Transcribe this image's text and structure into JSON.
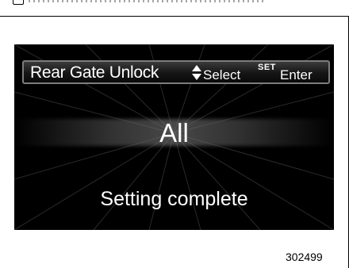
{
  "screen": {
    "header": {
      "title": "Rear Gate Unlock",
      "select_label": "Select",
      "set_icon_label": "SET",
      "enter_label": "Enter"
    },
    "selected_value": "All",
    "status_message": "Setting complete"
  },
  "figure_id": "302499",
  "colors": {
    "screen_background": "#000000",
    "text": "#ffffff",
    "header_border": "#7d7d7d"
  },
  "icons": {
    "select_icon": "up-down-triangle-icon",
    "set_icon": "set-button-icon"
  }
}
